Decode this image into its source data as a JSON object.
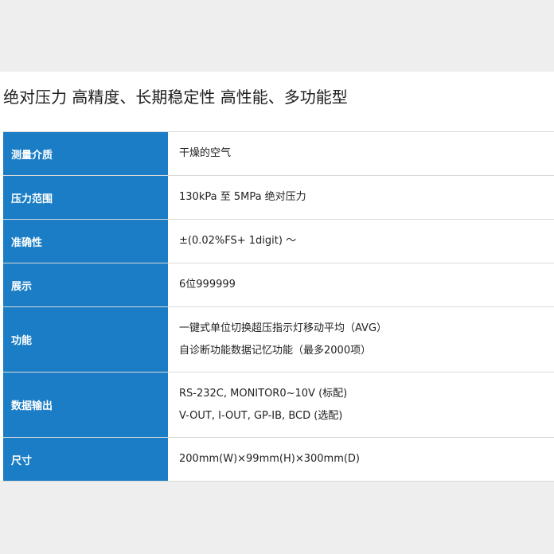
{
  "title": "绝对压力 高精度、长期稳定性 高性能、多功能型",
  "specs": [
    {
      "label": "测量介质",
      "lines": [
        "干燥的空气"
      ]
    },
    {
      "label": "压力范围",
      "lines": [
        "130kPa 至 5MPa 绝对压力"
      ]
    },
    {
      "label": "准确性",
      "lines": [
        "±(0.02%FS+ 1digit) ～"
      ]
    },
    {
      "label": "展示",
      "lines": [
        "6位999999"
      ]
    },
    {
      "label": "功能",
      "lines": [
        "一键式单位切换超压指示灯移动平均（AVG）",
        "自诊断功能数据记忆功能（最多2000项）"
      ]
    },
    {
      "label": "数据输出",
      "lines": [
        "RS-232C, MONITOR0~10V (标配)",
        "V-OUT, I-OUT, GP-IB, BCD (选配)"
      ]
    },
    {
      "label": "尺寸",
      "lines": [
        "200mm(W)×99mm(H)×300mm(D)"
      ]
    }
  ]
}
